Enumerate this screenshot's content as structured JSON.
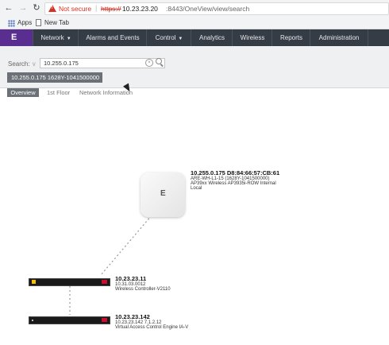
{
  "browser": {
    "security_label": "Not secure",
    "url_scheme": "https://",
    "url_host": "10.23.23.20",
    "url_rest": ":8443/OneView/view/search",
    "bookmarks": [
      {
        "label": "Apps",
        "icon": "apps-grid-icon"
      },
      {
        "label": "New Tab",
        "icon": "page-icon"
      }
    ]
  },
  "nav": {
    "logo": "E",
    "items": [
      {
        "label": "Network",
        "has_dropdown": true
      },
      {
        "label": "Alarms and Events",
        "has_dropdown": false
      },
      {
        "label": "Control",
        "has_dropdown": true
      },
      {
        "label": "Analytics",
        "has_dropdown": false
      },
      {
        "label": "Wireless",
        "has_dropdown": false
      },
      {
        "label": "Reports",
        "has_dropdown": false
      },
      {
        "label": "Administration",
        "has_dropdown": false
      }
    ],
    "background": "#353c46",
    "logo_background": "#5a2d91"
  },
  "search": {
    "label": "Search:",
    "value": "10.255.0.175",
    "chip": "10.255.0.175 1628Y-1041500000"
  },
  "tabs": [
    {
      "label": "Overview",
      "active": true
    },
    {
      "label": "1st Floor",
      "active": false
    },
    {
      "label": "Network Information",
      "active": false
    }
  ],
  "topology": {
    "ap": {
      "logo": "E",
      "title": "10.255.0.175 D8:84:66:57:CB:61",
      "line1": "ARE-WH-L1-15  (1628Y-1041500000)",
      "line2": "AP39xx  Wireless AP3935i-ROW Internal",
      "line3": "Local"
    },
    "controller": {
      "title": "10.23.23.11",
      "line1": "10.31.03.0012",
      "line2": "Wireless Controller-V2110"
    },
    "access_control": {
      "title": "10.23.23.142",
      "line1": "10.23.23.142 7.1.2.12",
      "line2": "Virtual Access Control Engine IA-V"
    }
  }
}
